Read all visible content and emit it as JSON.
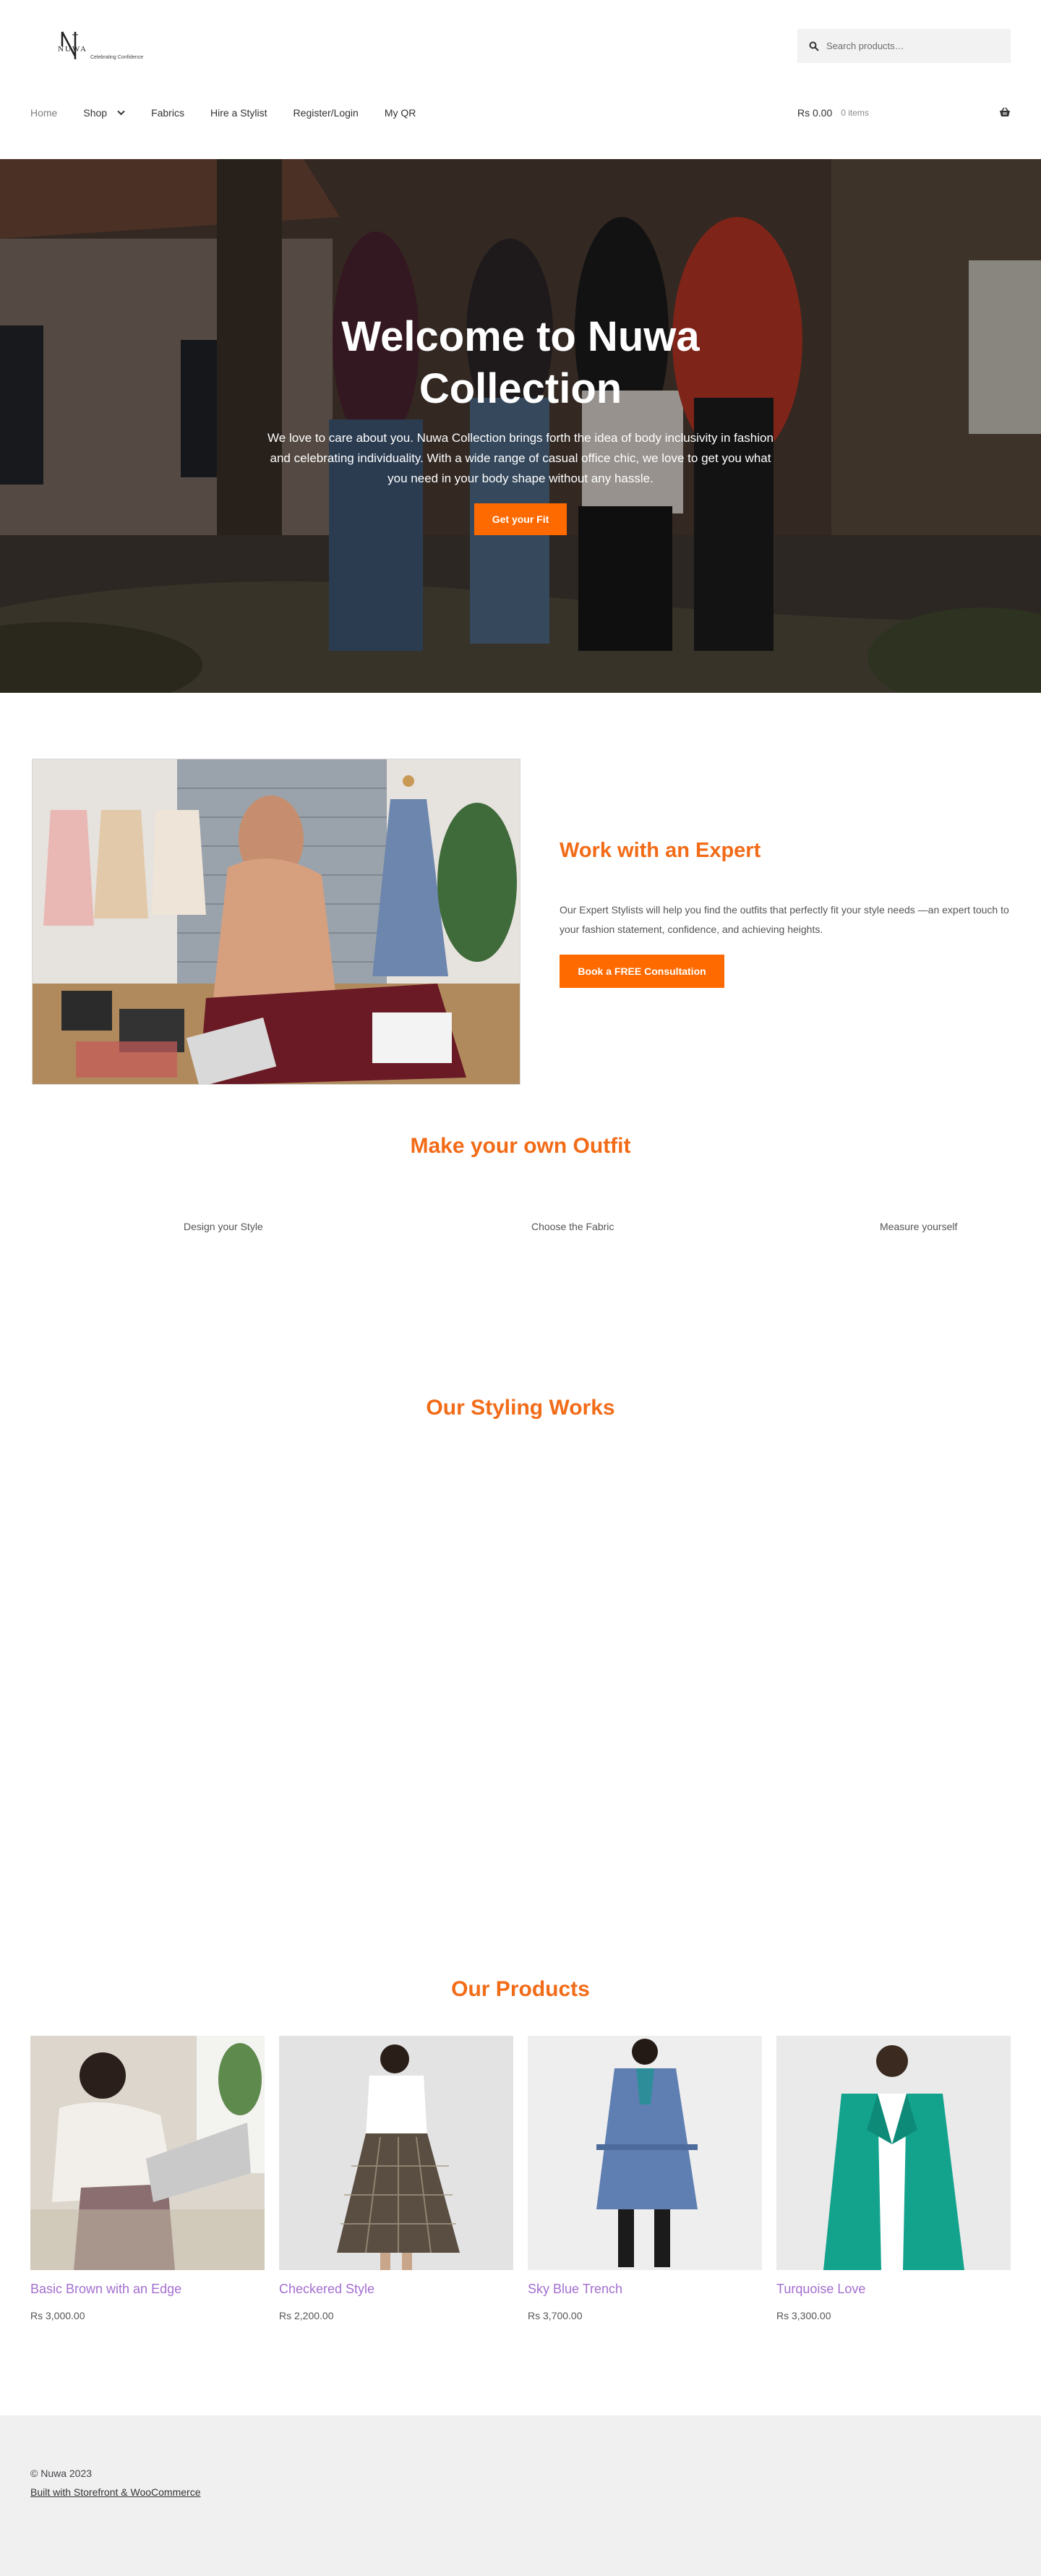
{
  "header": {
    "logo": {
      "brand": "NUWA",
      "tagline": "Celebrating Confidence"
    },
    "search": {
      "placeholder": "Search products…"
    },
    "nav": [
      "Home",
      "Shop",
      "Fabrics",
      "Hire a Stylist",
      "Register/Login",
      "My QR"
    ],
    "cart": {
      "amount": "Rs 0.00",
      "count": "0 items"
    }
  },
  "hero": {
    "title": "Welcome to Nuwa Collection",
    "text": "We love to care about you. Nuwa Collection brings forth the idea of body inclusivity in fashion and celebrating individuality. With a wide range of casual office chic, we love to get you what you need in your body shape without any hassle.",
    "button": "Get your Fit"
  },
  "expert": {
    "title": "Work with an Expert",
    "text": "Our Expert Stylists will help you find the outfits that perfectly fit your style needs —an expert touch to your fashion statement, confidence, and achieving heights.",
    "button": "Book a FREE Consultation"
  },
  "outfit": {
    "title": "Make your own Outfit",
    "steps": [
      "Design your Style",
      "Choose the Fabric",
      "Measure yourself"
    ]
  },
  "styling": {
    "title": "Our Styling Works"
  },
  "products": {
    "title": "Our Products",
    "items": [
      {
        "name": "Basic Brown with an Edge",
        "price": "Rs 3,000.00"
      },
      {
        "name": "Checkered Style",
        "price": "Rs 2,200.00"
      },
      {
        "name": "Sky Blue Trench",
        "price": "Rs 3,700.00"
      },
      {
        "name": "Turquoise Love",
        "price": "Rs 3,300.00"
      }
    ]
  },
  "footer": {
    "copyright": "© Nuwa 2023",
    "link": "Built with Storefront & WooCommerce"
  },
  "colors": {
    "accent": "#ff6a00",
    "heading": "#f26b17",
    "product_link": "#a36fcf",
    "footer_bg": "#f0f0f0"
  }
}
